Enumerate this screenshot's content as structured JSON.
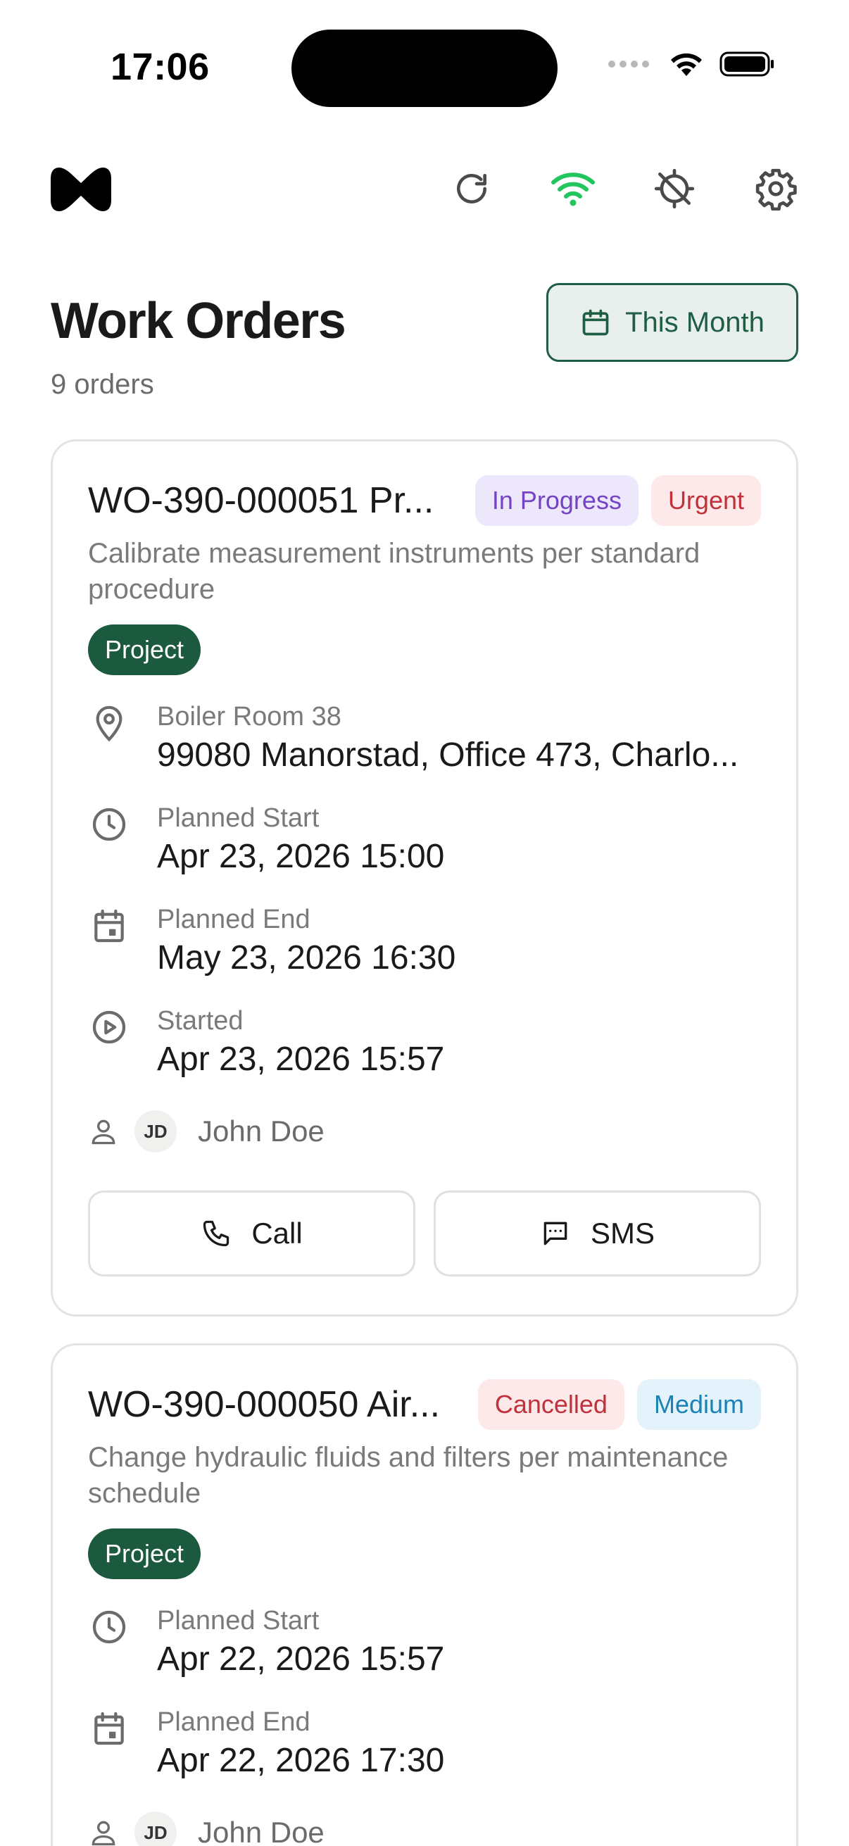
{
  "status_bar": {
    "time": "17:06"
  },
  "header": {
    "logo": "mirror-logo-icon",
    "actions": [
      "refresh-icon",
      "wifi-icon",
      "location-off-icon",
      "gear-icon"
    ],
    "online_color": "#22c55e"
  },
  "page": {
    "title": "Work Orders",
    "count": "9 orders",
    "period_filter": "This Month"
  },
  "colors": {
    "brand_green": "#1c5a3f",
    "text_muted": "#7a7a7a"
  },
  "orders": [
    {
      "title": "WO-390-000051 Pr...",
      "status": "In Progress",
      "priority": "Urgent",
      "description": "Calibrate measurement instruments per standard procedure",
      "type": "Project",
      "location_name": "Boiler Room 38",
      "location_address": "99080 Manorstad, Office 473, Charlo...",
      "planned_start_label": "Planned Start",
      "planned_start": "Apr 23, 2026 15:00",
      "planned_end_label": "Planned End",
      "planned_end": "May 23, 2026 16:30",
      "started_label": "Started",
      "started": "Apr 23, 2026 15:57",
      "assignee_initials": "JD",
      "assignee": "John Doe",
      "call_label": "Call",
      "sms_label": "SMS"
    },
    {
      "title": "WO-390-000050 Air...",
      "status": "Cancelled",
      "priority": "Medium",
      "description": "Change hydraulic fluids and filters per maintenance schedule",
      "type": "Project",
      "planned_start_label": "Planned Start",
      "planned_start": "Apr 22, 2026 15:57",
      "planned_end_label": "Planned End",
      "planned_end": "Apr 22, 2026 17:30",
      "assignee_initials": "JD",
      "assignee": "John Doe"
    }
  ]
}
